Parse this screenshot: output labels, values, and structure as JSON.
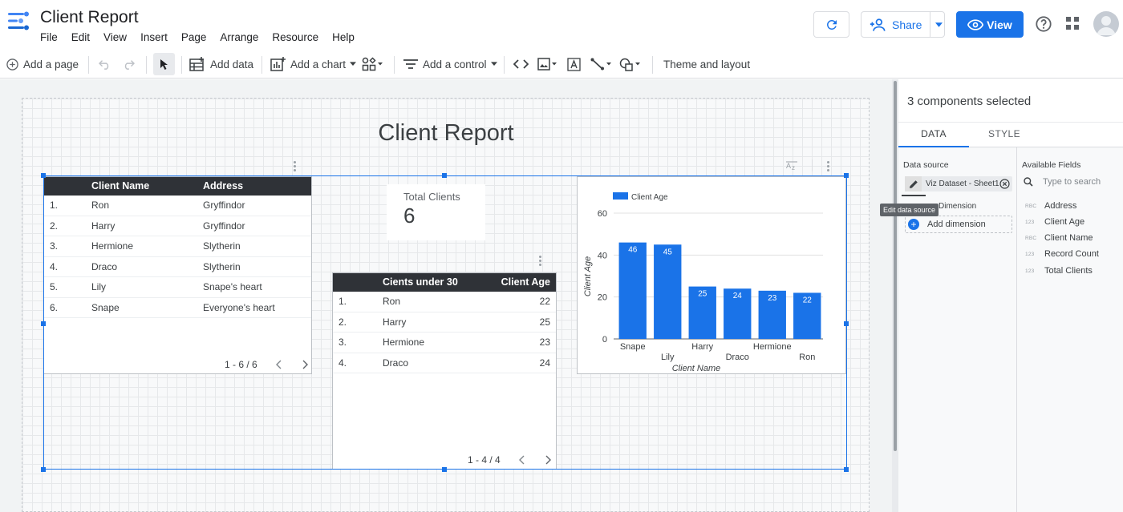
{
  "app": {
    "title": "Client Report"
  },
  "menu": [
    "File",
    "Edit",
    "View",
    "Insert",
    "Page",
    "Arrange",
    "Resource",
    "Help"
  ],
  "header": {
    "share_label": "Share",
    "view_label": "View"
  },
  "toolbar": {
    "add_page": "Add a page",
    "add_data": "Add data",
    "add_chart": "Add a chart",
    "add_control": "Add a control",
    "theme_layout": "Theme and layout"
  },
  "report": {
    "title": "Client Report"
  },
  "clients_table": {
    "columns": [
      "Client Name",
      "Address"
    ],
    "rows": [
      [
        "1.",
        "Ron",
        "Gryffindor"
      ],
      [
        "2.",
        "Harry",
        "Gryffindor"
      ],
      [
        "3.",
        "Hermione",
        "Slytherin"
      ],
      [
        "4.",
        "Draco",
        "Slytherin"
      ],
      [
        "5.",
        "Lily",
        "Snape's heart"
      ],
      [
        "6.",
        "Snape",
        "Everyone's heart"
      ]
    ],
    "pagination": "1 - 6 / 6"
  },
  "scorecard": {
    "label": "Total Clients",
    "value": "6"
  },
  "under30_table": {
    "columns": [
      "Cients under 30",
      "Client Age"
    ],
    "rows": [
      [
        "1.",
        "Ron",
        "22"
      ],
      [
        "2.",
        "Harry",
        "25"
      ],
      [
        "3.",
        "Hermione",
        "23"
      ],
      [
        "4.",
        "Draco",
        "24"
      ]
    ],
    "pagination": "1 - 4 / 4"
  },
  "chart_data": {
    "type": "bar",
    "categories": [
      "Snape",
      "Lily",
      "Harry",
      "Draco",
      "Hermione",
      "Ron"
    ],
    "series": [
      {
        "name": "Client Age",
        "values": [
          46,
          45,
          25,
          24,
          23,
          22
        ],
        "color": "#1a73e8"
      }
    ],
    "xlabel": "Client Name",
    "ylabel": "Client Age",
    "ylim": [
      0,
      60
    ],
    "yticks": [
      0,
      20,
      40,
      60
    ],
    "grid": true,
    "legend": "top-left",
    "data_labels": true
  },
  "panel": {
    "title": "3 components selected",
    "tabs": [
      "DATA",
      "STYLE"
    ],
    "data_source_label": "Data source",
    "data_source_name": "Viz Dataset - Sheet1",
    "tooltip": "Edit data source",
    "dimension_label": "Dimension",
    "add_dimension": "Add dimension",
    "available_fields_label": "Available Fields",
    "search_placeholder": "Type to search",
    "fields": [
      {
        "type": "RBC",
        "name": "Address"
      },
      {
        "type": "123",
        "name": "Client Age"
      },
      {
        "type": "RBC",
        "name": "Client Name"
      },
      {
        "type": "123",
        "name": "Record Count"
      },
      {
        "type": "123",
        "name": "Total Clients"
      }
    ]
  }
}
